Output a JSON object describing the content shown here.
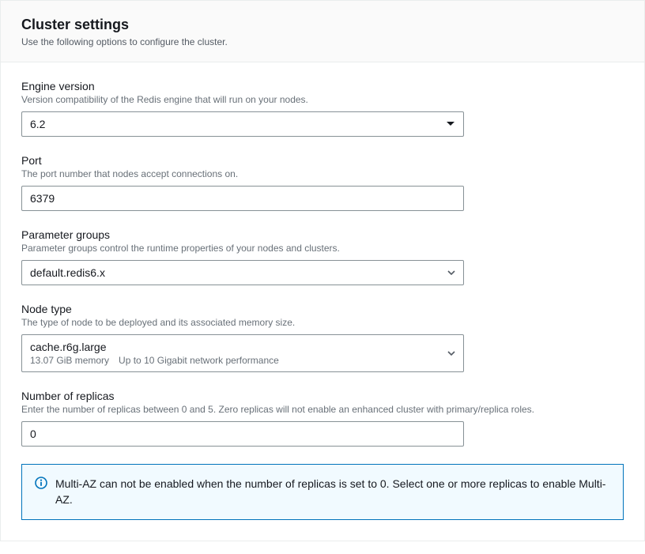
{
  "panel": {
    "title": "Cluster settings",
    "subtitle": "Use the following options to configure the cluster."
  },
  "engine_version": {
    "label": "Engine version",
    "help": "Version compatibility of the Redis engine that will run on your nodes.",
    "value": "6.2"
  },
  "port": {
    "label": "Port",
    "help": "The port number that nodes accept connections on.",
    "value": "6379"
  },
  "parameter_groups": {
    "label": "Parameter groups",
    "help": "Parameter groups control the runtime properties of your nodes and clusters.",
    "value": "default.redis6.x"
  },
  "node_type": {
    "label": "Node type",
    "help": "The type of node to be deployed and its associated memory size.",
    "value": "cache.r6g.large",
    "memory": "13.07 GiB memory",
    "network": "Up to 10 Gigabit network performance"
  },
  "replicas": {
    "label": "Number of replicas",
    "help": "Enter the number of replicas between 0 and 5. Zero replicas will not enable an enhanced cluster with primary/replica roles.",
    "value": "0"
  },
  "alert": {
    "text": "Multi-AZ can not be enabled when the number of replicas is set to 0. Select one or more replicas to enable Multi-AZ."
  }
}
